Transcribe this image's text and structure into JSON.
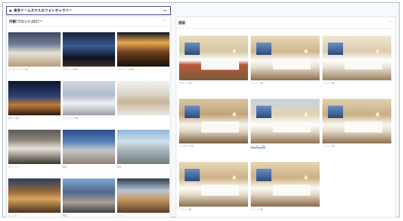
{
  "gallery": {
    "title": "東京ドームホテルのフォトギャラリー",
    "collapse_symbol": "−"
  },
  "left_panel": {
    "title": "外観/フロント/ロビー",
    "menu_symbol": "···",
    "photos": [
      {
        "caption": "ガーデンテラス (1階)",
        "style": "t-restaurant"
      },
      {
        "caption": "ラウンジ (43階)",
        "style": "t-bar"
      },
      {
        "caption": "スカイバー (43階)",
        "style": "t-lounge"
      },
      {
        "caption": "夜景 (43階)",
        "style": "t-night"
      },
      {
        "caption": "ビュッフェ (1階)",
        "style": "t-buffet"
      },
      {
        "caption": "",
        "style": "t-chandelier"
      },
      {
        "caption": "ダイニング",
        "style": "t-counter"
      },
      {
        "caption": "眺望",
        "style": "t-city"
      },
      {
        "caption": "眺望",
        "style": "t-cityday"
      },
      {
        "caption": "レストラン",
        "style": "t-diner"
      },
      {
        "caption": "眺望",
        "style": "t-aerial"
      },
      {
        "caption": "カフェ",
        "style": "t-cafe"
      }
    ]
  },
  "right_panel": {
    "title": "部屋",
    "menu_symbol": "···",
    "photos": [
      {
        "caption": "ダブル (一例)",
        "style": "t-room-a",
        "link": false
      },
      {
        "caption": "ツイン (一例)",
        "style": "t-room-b",
        "link": false
      },
      {
        "caption": "ツイン (一例)",
        "style": "t-room-c",
        "link": false
      },
      {
        "caption": "トリプル (一例)",
        "style": "t-room-d",
        "link": false
      },
      {
        "caption": "トリプル (一例)",
        "style": "t-room-e",
        "link": true
      },
      {
        "caption": "ツイン (一例)",
        "style": "t-room-f",
        "link": false
      },
      {
        "caption": "ツイン (一例)",
        "style": "t-room-g",
        "link": false
      },
      {
        "caption": "ツイン (一例)",
        "style": "t-room-h",
        "link": false
      }
    ]
  }
}
